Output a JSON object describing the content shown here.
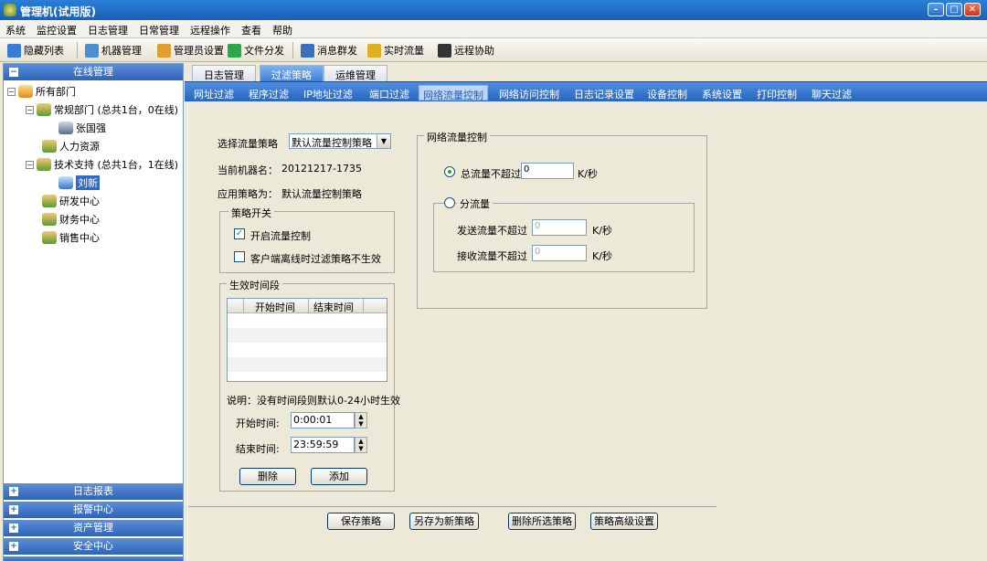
{
  "window": {
    "title": "管理机(试用版)",
    "controls": [
      "–",
      "□",
      "✕"
    ]
  },
  "menubar": [
    "系统",
    "监控设置",
    "日志管理",
    "日常管理",
    "远程操作",
    "查看",
    "帮助"
  ],
  "toolbar": [
    {
      "label": "隐藏列表",
      "icon": "list-icon",
      "color": "#3a7bd5"
    },
    {
      "label": "机器管理",
      "icon": "computer-icon",
      "color": "#4a8fd0"
    },
    {
      "label": "管理员设置",
      "icon": "users-icon",
      "color": "#e0a030"
    },
    {
      "label": "文件分发",
      "icon": "file-share-icon",
      "color": "#2aa84a"
    },
    {
      "label": "消息群发",
      "icon": "message-icon",
      "color": "#3a6fc0"
    },
    {
      "label": "实时流量",
      "icon": "traffic-icon",
      "color": "#e0b020"
    },
    {
      "label": "远程协助",
      "icon": "remote-icon",
      "color": "#333333"
    }
  ],
  "left": {
    "top_header": "在线管理",
    "tree": [
      {
        "label": "所有部门",
        "icon": "home-icon"
      },
      {
        "label": "常规部门 (总共1台，0在线)",
        "icon": "group-icon"
      },
      {
        "label": "张国强",
        "icon": "computer-icon"
      },
      {
        "label": "人力资源",
        "icon": "group-icon"
      },
      {
        "label": "技术支持 (总共1台，1在线)",
        "icon": "group-icon"
      },
      {
        "label": "刘新",
        "icon": "computer-icon"
      },
      {
        "label": "研发中心",
        "icon": "group-icon"
      },
      {
        "label": "财务中心",
        "icon": "group-icon"
      },
      {
        "label": "销售中心",
        "icon": "group-icon"
      }
    ],
    "bottom_sections": [
      "日志报表",
      "报警中心",
      "资产管理",
      "安全中心",
      ""
    ]
  },
  "tabs_top": [
    "日志管理",
    "过滤策略",
    "运维管理"
  ],
  "tabs_top_active": 1,
  "tabs_sub": [
    "网址过滤",
    "程序过滤",
    "IP地址过滤",
    "端口过滤",
    "网络流量控制",
    "网络访问控制",
    "日志记录设置",
    "设备控制",
    "系统设置",
    "打印控制",
    "聊天过滤"
  ],
  "tabs_sub_active": 4,
  "form": {
    "strategy_label": "选择流量策略",
    "strategy_value": "默认流量控制策略",
    "machine_label": "当前机器名：",
    "machine_value": "20121217-1735",
    "applied_label": "应用策略为：",
    "applied_value": "默认流量控制策略",
    "switch_group": "策略开关",
    "enable_traffic": "开启流量控制",
    "enable_traffic_checked": true,
    "offline_disable": "客户端离线时过滤策略不生效",
    "offline_disable_checked": false,
    "time_group": "生效时间段",
    "time_cols": [
      "开始时间",
      "结束时间"
    ],
    "note": "说明：没有时间段则默认0-24小时生效",
    "start_label": "开始时间:",
    "start_value": "0:00:01",
    "end_label": "结束时间:",
    "end_value": "23:59:59",
    "delete_btn": "删除",
    "add_btn": "添加"
  },
  "net": {
    "group": "网络流量控制",
    "total_label": "总流量不超过",
    "total_value": "0",
    "total_unit": "K/秒",
    "total_selected": true,
    "split_label": "分流量",
    "send_label": "发送流量不超过",
    "send_value": "0",
    "send_unit": "K/秒",
    "recv_label": "接收流量不超过",
    "recv_value": "0",
    "recv_unit": "K/秒"
  },
  "bottom_buttons": [
    "保存策略",
    "另存为新策略",
    "删除所选策略",
    "策略高级设置"
  ]
}
